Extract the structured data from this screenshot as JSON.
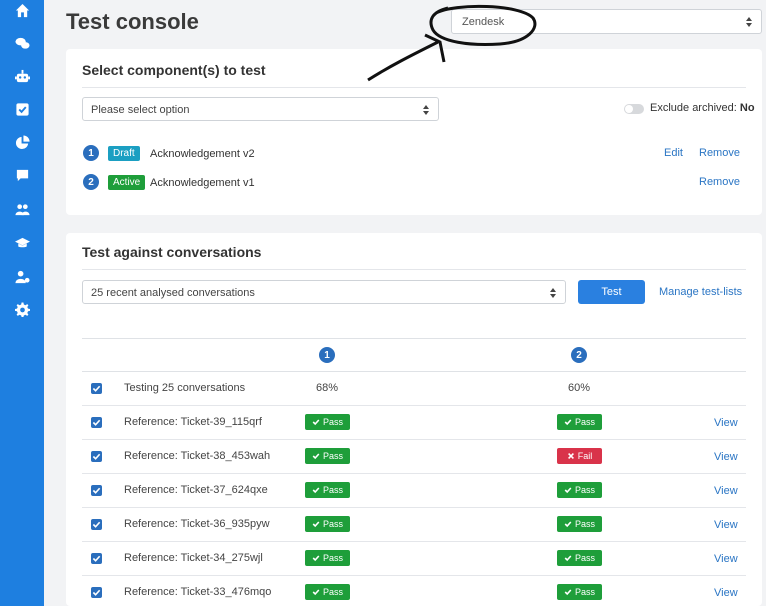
{
  "sidebar": {
    "icons": [
      "home-icon",
      "chat-bubbles-icon",
      "robot-icon",
      "checkbox-icon",
      "pie-chart-icon",
      "comment-icon",
      "users-icon",
      "graduation-cap-icon",
      "user-settings-icon",
      "gear-icon"
    ]
  },
  "header": {
    "title": "Test console",
    "integration_select": {
      "value": "Zendesk"
    }
  },
  "components": {
    "title": "Select component(s) to test",
    "select_placeholder": "Please select option",
    "exclude_archived": {
      "label": "Exclude archived:",
      "value": "No"
    },
    "items": [
      {
        "num": "1",
        "status": "Draft",
        "name": "Acknowledgement v2",
        "edit": "Edit",
        "remove": "Remove"
      },
      {
        "num": "2",
        "status": "Active",
        "name": "Acknowledgement v1",
        "edit": "",
        "remove": "Remove"
      }
    ]
  },
  "conversations": {
    "title": "Test against conversations",
    "select_value": "25 recent analysed conversations",
    "test_button": "Test",
    "manage_link": "Manage test-lists",
    "columns": [
      "1",
      "2"
    ],
    "summary": {
      "label": "Testing 25 conversations",
      "c1": "68%",
      "c2": "60%"
    },
    "rows": [
      {
        "label": "Reference: Ticket-39_115qrf",
        "r1": "Pass",
        "r2": "Pass",
        "view": "View"
      },
      {
        "label": "Reference: Ticket-38_453wah",
        "r1": "Pass",
        "r2": "Fail",
        "view": "View"
      },
      {
        "label": "Reference: Ticket-37_624qxe",
        "r1": "Pass",
        "r2": "Pass",
        "view": "View"
      },
      {
        "label": "Reference: Ticket-36_935pyw",
        "r1": "Pass",
        "r2": "Pass",
        "view": "View"
      },
      {
        "label": "Reference: Ticket-34_275wjl",
        "r1": "Pass",
        "r2": "Pass",
        "view": "View"
      },
      {
        "label": "Reference: Ticket-33_476mqo",
        "r1": "Pass",
        "r2": "Pass",
        "view": "View"
      }
    ]
  },
  "colors": {
    "sidebar": "#1e7fe0",
    "pass": "#1e9e3a",
    "fail": "#d9334a",
    "draft": "#1b9fc2",
    "link": "#2a75c4"
  }
}
